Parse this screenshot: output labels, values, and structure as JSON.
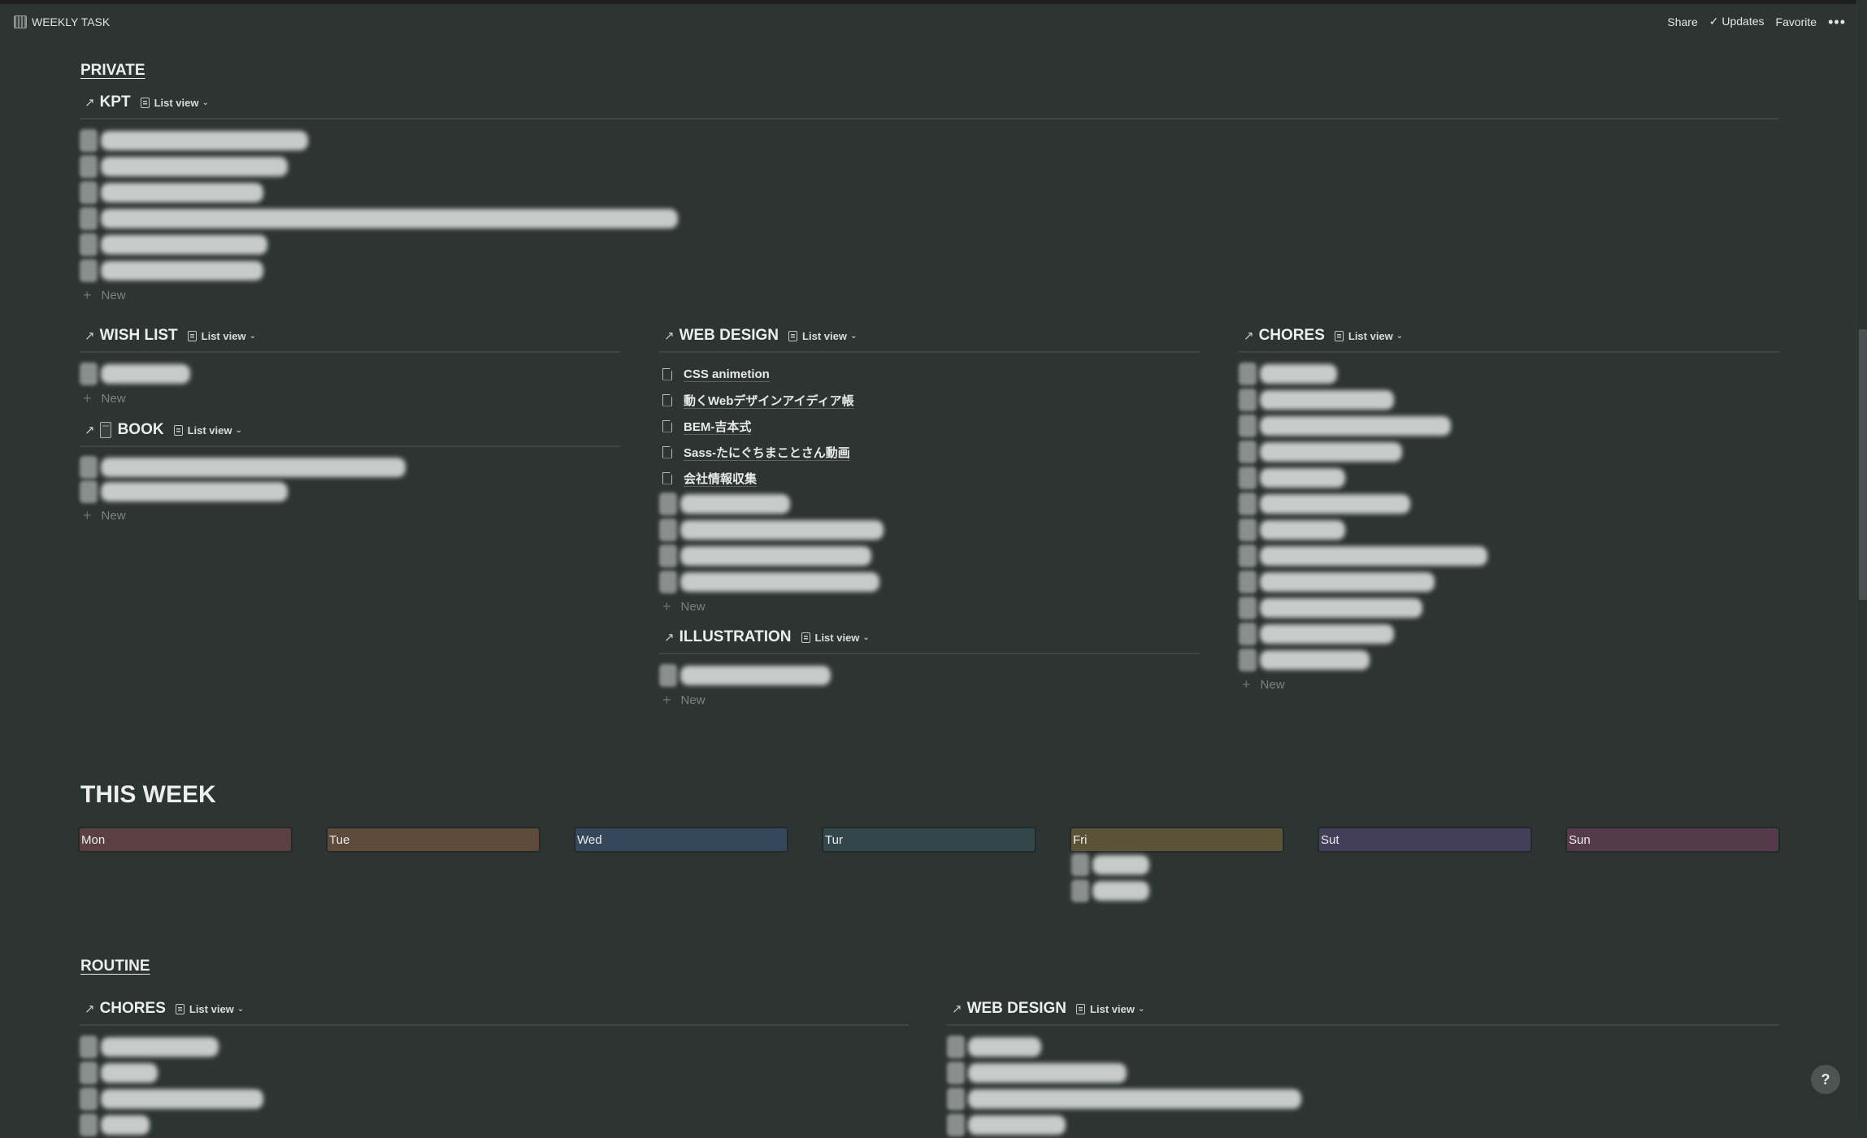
{
  "topbar": {
    "title": "WEEKLY TASK",
    "icon": "calendar-icon",
    "actions": {
      "share": "Share",
      "updates": "Updates",
      "favorite": "Favorite",
      "more": "•••"
    },
    "updates_icon": "check-icon"
  },
  "common": {
    "list_view": "List view",
    "new": "New",
    "arrow": "↗",
    "chevron": "⌄",
    "plus": "+"
  },
  "private": {
    "title": "PRIVATE",
    "kpt": {
      "title": "KPT",
      "items_redacted": 6
    },
    "wish_list": {
      "title": "WISH LIST",
      "items_redacted": 1
    },
    "book": {
      "title": "BOOK",
      "icon": "book-icon",
      "items_redacted": 2
    },
    "web_design": {
      "title": "WEB DESIGN",
      "pages": [
        "CSS animetion",
        "動くWebデザインアイディア帳",
        "BEM-吉本式",
        "Sass-たにぐちまことさん動画",
        "会社情報収集"
      ],
      "items_redacted": 4
    },
    "illustration": {
      "title": "ILLUSTRATION",
      "items_redacted": 1
    },
    "chores": {
      "title": "CHORES",
      "items_redacted": 12
    }
  },
  "this_week": {
    "title": "THIS WEEK",
    "columns": [
      {
        "label": "Mon",
        "color": "#5a4040",
        "cards_redacted": 0
      },
      {
        "label": "Tue",
        "color": "#5e4a3a",
        "cards_redacted": 0
      },
      {
        "label": "Wed",
        "color": "#35475a",
        "cards_redacted": 0
      },
      {
        "label": "Tur",
        "color": "#33474a",
        "cards_redacted": 0
      },
      {
        "label": "Fri",
        "color": "#5a5337",
        "cards_redacted": 2
      },
      {
        "label": "Sut",
        "color": "#433f5a",
        "cards_redacted": 0
      },
      {
        "label": "Sun",
        "color": "#553a4c",
        "cards_redacted": 0
      }
    ]
  },
  "routine": {
    "title": "ROUTINE",
    "chores": {
      "title": "CHORES"
    },
    "web_design": {
      "title": "WEB DESIGN"
    }
  },
  "help": "?"
}
